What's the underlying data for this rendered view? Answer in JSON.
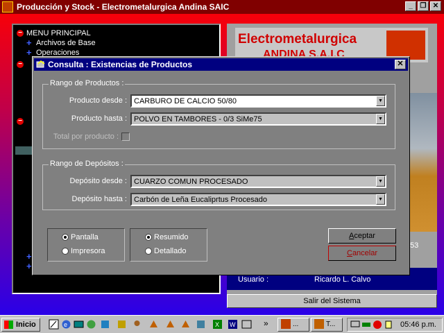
{
  "app": {
    "title": "Producción y Stock - Electrometalurgica Andina SAIC",
    "window_buttons": {
      "minimize": "_",
      "restore": "❐",
      "close": "✕"
    }
  },
  "tree": {
    "items": [
      {
        "label": "MENU PRINCIPAL",
        "kind": "minus"
      },
      {
        "label": "Archivos de Base",
        "kind": "plus"
      },
      {
        "label": "Operaciones",
        "kind": "plus"
      }
    ]
  },
  "right_panel": {
    "logo_line1": "Electrometalurgica",
    "logo_line2": "ANDINA S.A.I.C",
    "partial_number": "53",
    "usuario_label": "Usuario :",
    "usuario_value": "Ricardo L. Calvo",
    "salir_label": "Salir del Sistema"
  },
  "dialog": {
    "title": "Consulta : Existencias de Productos",
    "close": "✕",
    "productos": {
      "group_label": "Rango de Productos :",
      "desde_label": "Producto desde :",
      "desde_value": "CARBURO DE CALCIO 50/80",
      "hasta_label": "Producto hasta :",
      "hasta_value": "POLVO EN TAMBORES - 0/3 SiMe75",
      "total_label": "Total por producto :",
      "total_checked": false
    },
    "depositos": {
      "group_label": "Rango de Depósitos :",
      "desde_label": "Depósito desde :",
      "desde_value": "CUARZO COMUN PROCESADO",
      "hasta_label": "Depósito hasta :",
      "hasta_value": "Carbón de Leña Eucaliprtus Procesado"
    },
    "output": {
      "pantalla": "Pantalla",
      "impresora": "Impresora",
      "selected": "Pantalla"
    },
    "detail": {
      "resumido": "Resumido",
      "detallado": "Detallado",
      "selected": "Resumido"
    },
    "aceptar": {
      "underlined": "A",
      "rest": "ceptar"
    },
    "cancelar": {
      "underlined": "C",
      "rest": "ancelar"
    }
  },
  "taskbar": {
    "start_label": "Inicio",
    "chevron": "»",
    "tasks": [
      "...",
      "T..."
    ],
    "clock": "05:46 p.m."
  }
}
